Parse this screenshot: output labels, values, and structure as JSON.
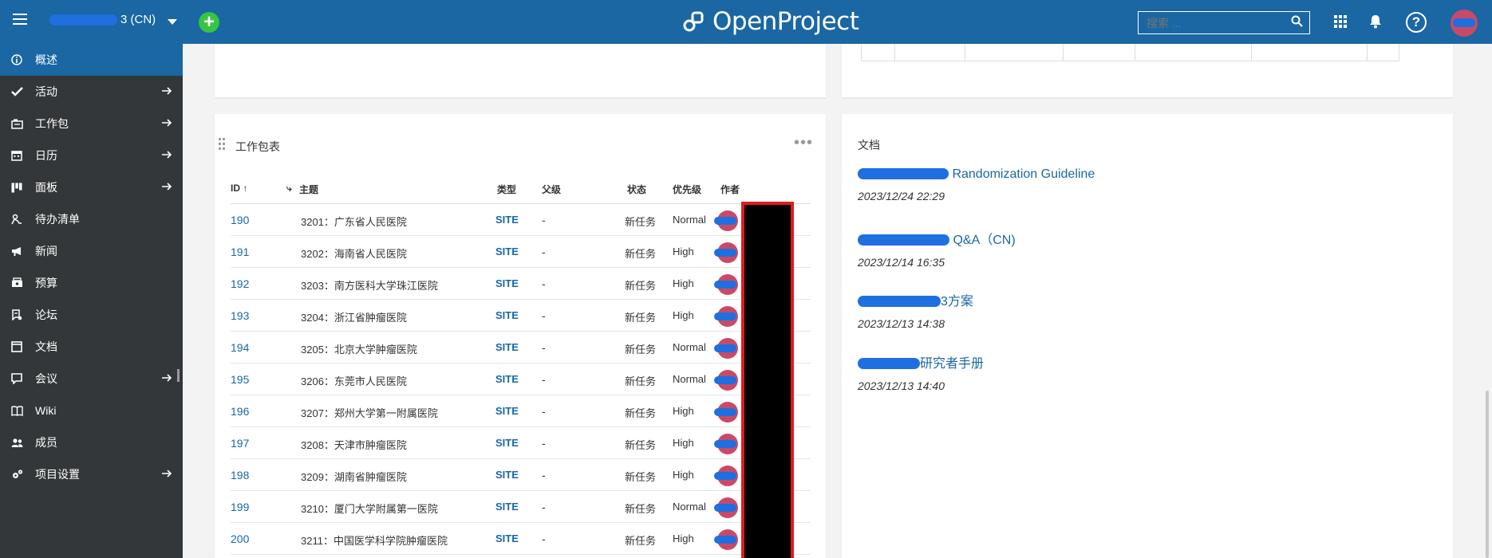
{
  "header": {
    "project_name": "3 (CN)",
    "logo_text": "OpenProject",
    "search_placeholder": "搜索 ..."
  },
  "sidebar": {
    "items": [
      {
        "label": "概述",
        "icon": "info-icon",
        "active": true,
        "arrow": false
      },
      {
        "label": "活动",
        "icon": "checkmark-icon",
        "active": false,
        "arrow": true
      },
      {
        "label": "工作包",
        "icon": "work-packages-icon",
        "active": false,
        "arrow": true
      },
      {
        "label": "日历",
        "icon": "calendar-icon",
        "active": false,
        "arrow": true
      },
      {
        "label": "面板",
        "icon": "boards-icon",
        "active": false,
        "arrow": true
      },
      {
        "label": "待办清单",
        "icon": "backlogs-icon",
        "active": false,
        "arrow": false
      },
      {
        "label": "新闻",
        "icon": "megaphone-icon",
        "active": false,
        "arrow": false
      },
      {
        "label": "预算",
        "icon": "budget-icon",
        "active": false,
        "arrow": false
      },
      {
        "label": "论坛",
        "icon": "forum-icon",
        "active": false,
        "arrow": false
      },
      {
        "label": "文档",
        "icon": "document-icon",
        "active": false,
        "arrow": false
      },
      {
        "label": "会议",
        "icon": "meetings-icon",
        "active": false,
        "arrow": true
      },
      {
        "label": "Wiki",
        "icon": "wiki-icon",
        "active": false,
        "arrow": false
      },
      {
        "label": "成员",
        "icon": "members-icon",
        "active": false,
        "arrow": false
      },
      {
        "label": "项目设置",
        "icon": "settings-icon",
        "active": false,
        "arrow": true
      }
    ]
  },
  "work_packages": {
    "title": "工作包表",
    "columns": {
      "id": "ID",
      "subject": "主题",
      "type": "类型",
      "parent": "父级",
      "status": "状态",
      "priority": "优先级",
      "author": "作者"
    },
    "rows": [
      {
        "id": "190",
        "subject": "3201：广东省人民医院",
        "type": "SITE",
        "parent": "-",
        "status": "新任务",
        "priority": "Normal"
      },
      {
        "id": "191",
        "subject": "3202：海南省人民医院",
        "type": "SITE",
        "parent": "-",
        "status": "新任务",
        "priority": "High"
      },
      {
        "id": "192",
        "subject": "3203：南方医科大学珠江医院",
        "type": "SITE",
        "parent": "-",
        "status": "新任务",
        "priority": "High"
      },
      {
        "id": "193",
        "subject": "3204：浙江省肿瘤医院",
        "type": "SITE",
        "parent": "-",
        "status": "新任务",
        "priority": "High"
      },
      {
        "id": "194",
        "subject": "3205：北京大学肿瘤医院",
        "type": "SITE",
        "parent": "-",
        "status": "新任务",
        "priority": "Normal"
      },
      {
        "id": "195",
        "subject": "3206：东莞市人民医院",
        "type": "SITE",
        "parent": "-",
        "status": "新任务",
        "priority": "Normal"
      },
      {
        "id": "196",
        "subject": "3207：郑州大学第一附属医院",
        "type": "SITE",
        "parent": "-",
        "status": "新任务",
        "priority": "High"
      },
      {
        "id": "197",
        "subject": "3208：天津市肿瘤医院",
        "type": "SITE",
        "parent": "-",
        "status": "新任务",
        "priority": "High"
      },
      {
        "id": "198",
        "subject": "3209：湖南省肿瘤医院",
        "type": "SITE",
        "parent": "-",
        "status": "新任务",
        "priority": "High"
      },
      {
        "id": "199",
        "subject": "3210：厦门大学附属第一医院",
        "type": "SITE",
        "parent": "-",
        "status": "新任务",
        "priority": "Normal"
      },
      {
        "id": "200",
        "subject": "3211：中国医学科学院肿瘤医院",
        "type": "SITE",
        "parent": "-",
        "status": "新任务",
        "priority": "High"
      }
    ]
  },
  "documents": {
    "title": "文档",
    "items": [
      {
        "title": "Randomization Guideline",
        "date": "2023/12/24 22:29"
      },
      {
        "title": "Q&A（CN)",
        "date": "2023/12/14 16:35"
      },
      {
        "title": "3方案",
        "date": "2023/12/13 14:38"
      },
      {
        "title": "研究者手册",
        "date": "2023/12/13 14:40"
      }
    ]
  },
  "colors": {
    "header": "#1a67a3",
    "sidebar": "#333739",
    "link": "#1a67a3",
    "add_button": "#35c53f"
  }
}
